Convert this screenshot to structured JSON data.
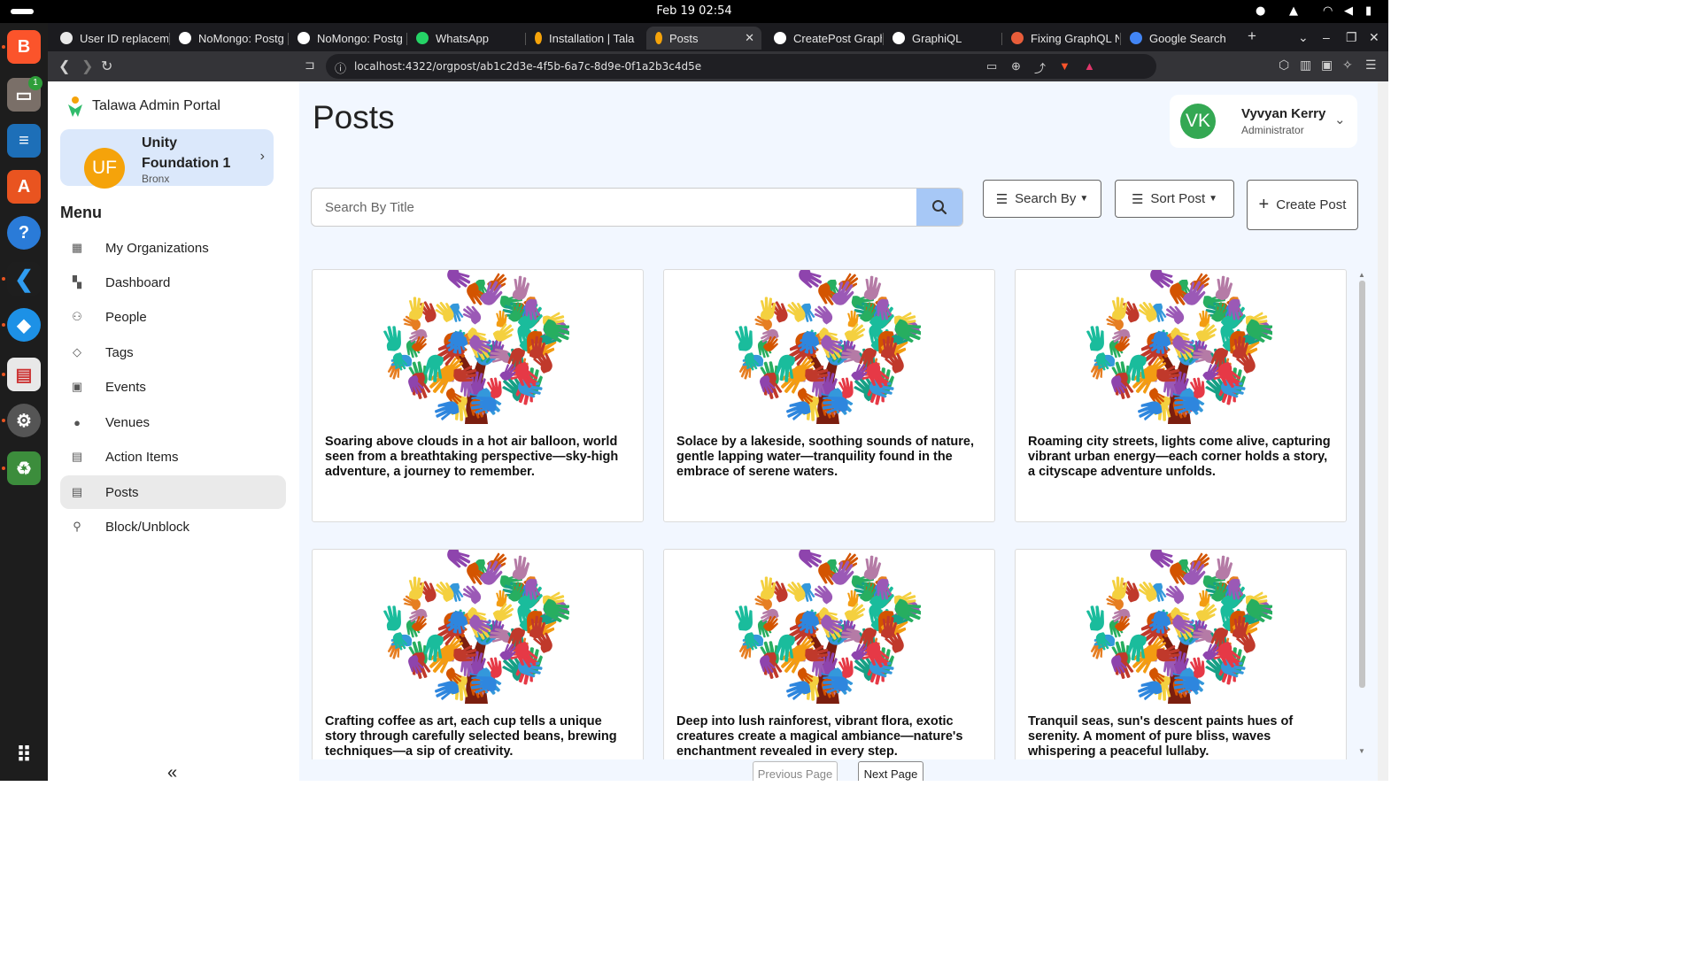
{
  "os": {
    "clock": "Feb 19  02:54"
  },
  "browser": {
    "tabs": [
      {
        "label": "User ID replacem",
        "favicon_color": "#e8e8e8"
      },
      {
        "label": "NoMongo: Postg",
        "favicon_color": "#ffffff"
      },
      {
        "label": "NoMongo: Postg",
        "favicon_color": "#ffffff"
      },
      {
        "label": "WhatsApp",
        "favicon_color": "#25d366"
      },
      {
        "label": "Installation | Tala",
        "favicon_color": "#f5a30a"
      },
      {
        "label": "Posts",
        "favicon_color": "#f5a30a"
      },
      {
        "label": "CreatePost Graph",
        "favicon_color": "#ffffff"
      },
      {
        "label": "GraphiQL",
        "favicon_color": "#ffffff"
      },
      {
        "label": "Fixing GraphQL N",
        "favicon_color": "#e85d3a"
      },
      {
        "label": "Google Search",
        "favicon_color": "#4285f4"
      }
    ],
    "url": "localhost:4322/orgpost/ab1c2d3e-4f5b-6a7c-8d9e-0f1a2b3c4d5e"
  },
  "sidebar": {
    "brand": "Talawa Admin Portal",
    "org": {
      "initials": "UF",
      "name": "Unity Foundation 1",
      "city": "Bronx"
    },
    "menu_heading": "Menu",
    "items": [
      {
        "label": "My Organizations",
        "icon": "building-icon"
      },
      {
        "label": "Dashboard",
        "icon": "dashboard-icon"
      },
      {
        "label": "People",
        "icon": "people-icon"
      },
      {
        "label": "Tags",
        "icon": "tag-icon"
      },
      {
        "label": "Events",
        "icon": "calendar-icon"
      },
      {
        "label": "Venues",
        "icon": "location-pin-icon"
      },
      {
        "label": "Action Items",
        "icon": "action-items-icon"
      },
      {
        "label": "Posts",
        "icon": "posts-icon"
      },
      {
        "label": "Block/Unblock",
        "icon": "block-user-icon"
      }
    ],
    "active_item": "Posts"
  },
  "main": {
    "title": "Posts",
    "user": {
      "initials": "VK",
      "name": "Vyvyan Kerry",
      "role": "Administrator"
    },
    "search": {
      "placeholder": "Search By Title",
      "value": ""
    },
    "buttons": {
      "search_by": "Search By",
      "sort_post": "Sort Post",
      "create_post": "Create Post"
    },
    "posts": [
      {
        "text": "Soaring above clouds in a hot air balloon, world seen from a breathtaking perspective—sky-high adventure, a journey to remember."
      },
      {
        "text": "Solace by a lakeside, soothing sounds of nature, gentle lapping water—tranquility found in the embrace of serene waters."
      },
      {
        "text": "Roaming city streets, lights come alive, capturing vibrant urban energy—each corner holds a story, a cityscape adventure unfolds."
      },
      {
        "text": "Crafting coffee as art, each cup tells a unique story through carefully selected beans, brewing techniques—a sip of creativity."
      },
      {
        "text": "Deep into lush rainforest, vibrant flora, exotic creatures create a magical ambiance—nature's enchantment revealed in every step."
      },
      {
        "text": "Tranquil seas, sun's descent paints hues of serenity. A moment of pure bliss, waves whispering a peaceful lullaby."
      }
    ],
    "pagination": {
      "previous": "Previous Page",
      "next": "Next Page"
    }
  },
  "colors": {
    "accent": "#a7c8f6",
    "org_card": "#dbe8fb",
    "org_avatar": "#f5a30a",
    "user_avatar": "#34a853",
    "main_bg": "#f2f7ff"
  }
}
